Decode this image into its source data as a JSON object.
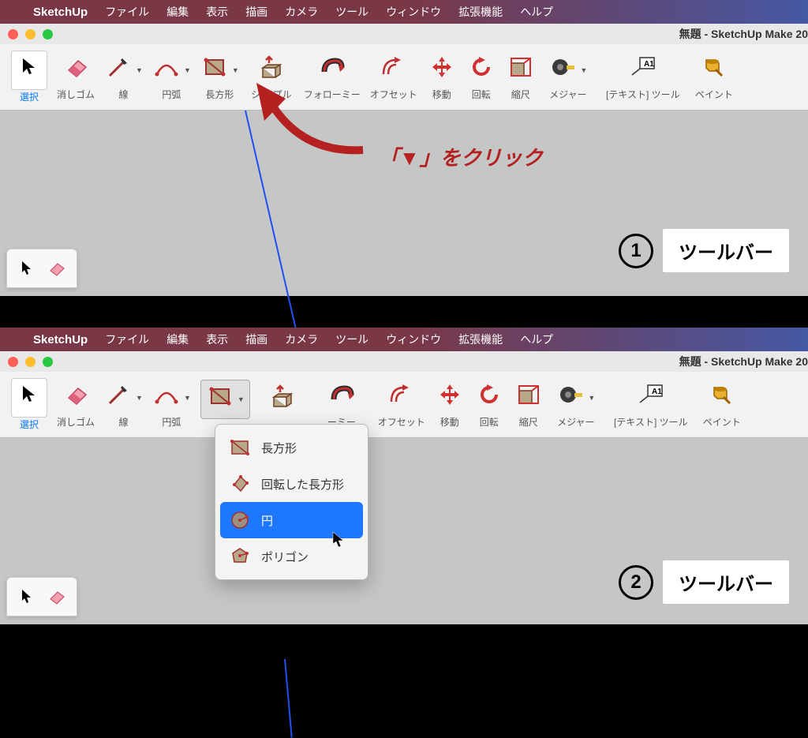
{
  "menubar": {
    "app": "SketchUp",
    "items": [
      "ファイル",
      "編集",
      "表示",
      "描画",
      "カメラ",
      "ツール",
      "ウィンドウ",
      "拡張機能",
      "ヘルプ"
    ]
  },
  "window": {
    "title": "無題 - SketchUp Make 20"
  },
  "tools": {
    "select": "選択",
    "eraser": "消しゴム",
    "line": "線",
    "arc": "円弧",
    "rectangle": "長方形",
    "pushpull_partial": "シュ/プル",
    "followme": "フォローミー",
    "followme_partial": "ーミー",
    "offset": "オフセット",
    "move": "移動",
    "rotate": "回転",
    "scale": "縮尺",
    "tape": "メジャー",
    "text": "[テキスト] ツール",
    "paint": "ペイント"
  },
  "dropdown": {
    "rectangle": "長方形",
    "rotated_rect": "回転した長方形",
    "circle": "円",
    "polygon": "ポリゴン"
  },
  "annotations": {
    "click_text": "「▼」をクリック",
    "toolbar_label": "ツールバー",
    "num1": "1",
    "num2": "2"
  }
}
